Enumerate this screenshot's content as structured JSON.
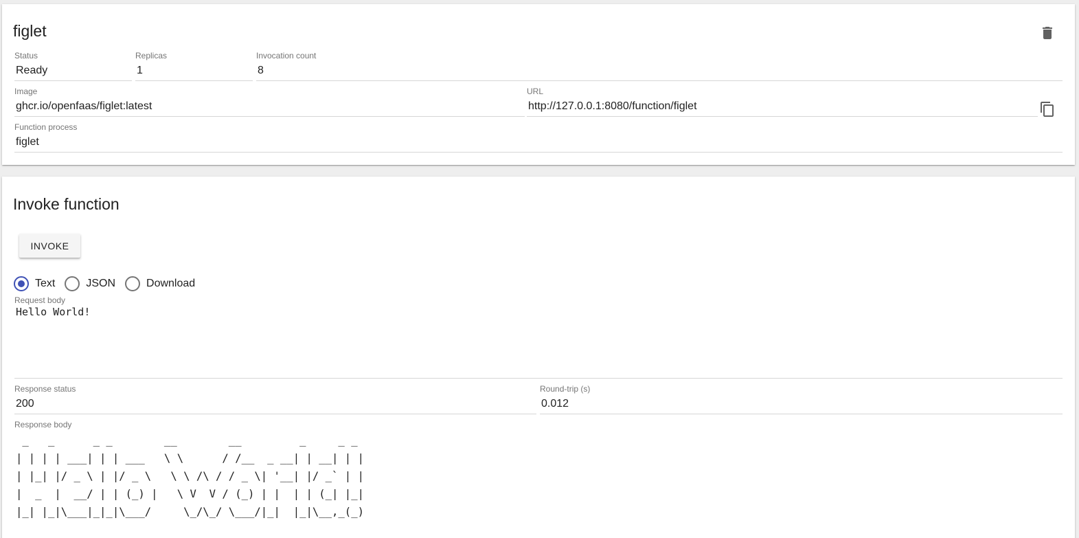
{
  "function": {
    "name": "figlet",
    "status_label": "Status",
    "status_value": "Ready",
    "replicas_label": "Replicas",
    "replicas_value": "1",
    "invocation_label": "Invocation count",
    "invocation_value": "8",
    "image_label": "Image",
    "image_value": "ghcr.io/openfaas/figlet:latest",
    "url_label": "URL",
    "url_value": "http://127.0.0.1:8080/function/figlet",
    "process_label": "Function process",
    "process_value": "figlet"
  },
  "invoke": {
    "title": "Invoke function",
    "button_label": "INVOKE",
    "content_types": [
      {
        "label": "Text",
        "checked": true
      },
      {
        "label": "JSON",
        "checked": false
      },
      {
        "label": "Download",
        "checked": false
      }
    ],
    "request_label": "Request body",
    "request_value": "Hello World!",
    "response_status_label": "Response status",
    "response_status_value": "200",
    "roundtrip_label": "Round-trip (s)",
    "roundtrip_value": "0.012",
    "response_body_label": "Response body",
    "response_body_value": " _   _      _ _        __        __         _     _ _ \n| | | | ___| | | ___   \\ \\      / /__  _ __| | __| | |\n| |_| |/ _ \\ | |/ _ \\   \\ \\ /\\ / / _ \\| '__| |/ _` | |\n|  _  |  __/ | | (_) |   \\ V  V / (_) | |  | | (_| |_|\n|_| |_|\\___|_|_|\\___/     \\_/\\_/ \\___/|_|  |_|\\__,_(_)"
  },
  "icons": {
    "delete": "trash-icon",
    "copy": "copy-icon"
  },
  "colors": {
    "accent": "#3f51b5",
    "label": "#757575",
    "icon": "#616161"
  }
}
